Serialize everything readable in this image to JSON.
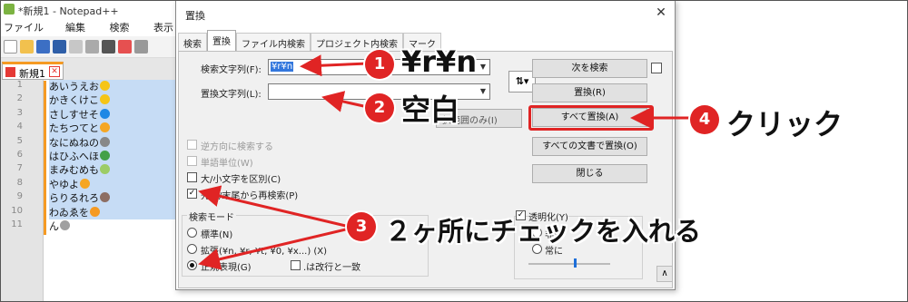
{
  "npp": {
    "title": "*新規1 - Notepad++",
    "menu": [
      "ファイル(F)",
      "編集(E)",
      "検索(S)",
      "表示(V"
    ],
    "tab_label": "新規1",
    "line_numbers": [
      "1",
      "2",
      "3",
      "4",
      "5",
      "6",
      "7",
      "8",
      "9",
      "10",
      "11"
    ],
    "lines": [
      "あいうえお",
      "かきくけこ",
      "さしすせそ",
      "たちつてと",
      "なにぬねの",
      "はひふへほ",
      "まみむめも",
      "やゆよ",
      "らりるれろ",
      "わゐゑを",
      "ん"
    ],
    "emoji_colors": [
      "#f5c518",
      "#f5c518",
      "#1e88e5",
      "#f5a623",
      "#888888",
      "#43a047",
      "#9ccc65",
      "#f5a623",
      "#8d6e63",
      "#f59a23",
      "#a0a0a0"
    ]
  },
  "dialog": {
    "title": "置換",
    "close": "✕",
    "tabs": [
      "検索",
      "置換",
      "ファイル内検索",
      "プロジェクト内検索",
      "マーク"
    ],
    "find_label": "検索文字列(F):",
    "find_value": "¥r¥n",
    "replace_label": "置換文字列(L):",
    "replace_value": "",
    "swap_icon": "⇅",
    "selection_only_partial": "択範囲のみ(I)",
    "options": {
      "backward": "逆方向に検索する",
      "whole_word": "単語単位(W)",
      "match_case": "大/小文字を区別(C)",
      "wrap_around": "先頭/末尾から再検索(P)"
    },
    "search_mode": {
      "title": "検索モード",
      "normal": "標準(N)",
      "extended": "拡張(¥n, ¥r, ¥t, ¥0, ¥x...) (X)",
      "regex": "正規表現(G)",
      "dot_newline": ".は改行と一致"
    },
    "transparency": {
      "title": "透明化(Y)",
      "on_lose_focus": "非選",
      "always": "常に"
    },
    "buttons": {
      "find_next": "次を検索",
      "replace": "置換(R)",
      "replace_all": "すべて置換(A)",
      "replace_all_docs": "すべての文書で置換(O)",
      "close": "閉じる"
    },
    "scroll_up": "∧"
  },
  "annotations": {
    "step1": {
      "num": "1",
      "text": "¥r¥n"
    },
    "step2": {
      "num": "2",
      "text": "空白"
    },
    "step3": {
      "num": "3",
      "text": "２ヶ所にチェックを入れる"
    },
    "step4": {
      "num": "4",
      "text": "クリック"
    },
    "accent_color": "#e02424"
  }
}
